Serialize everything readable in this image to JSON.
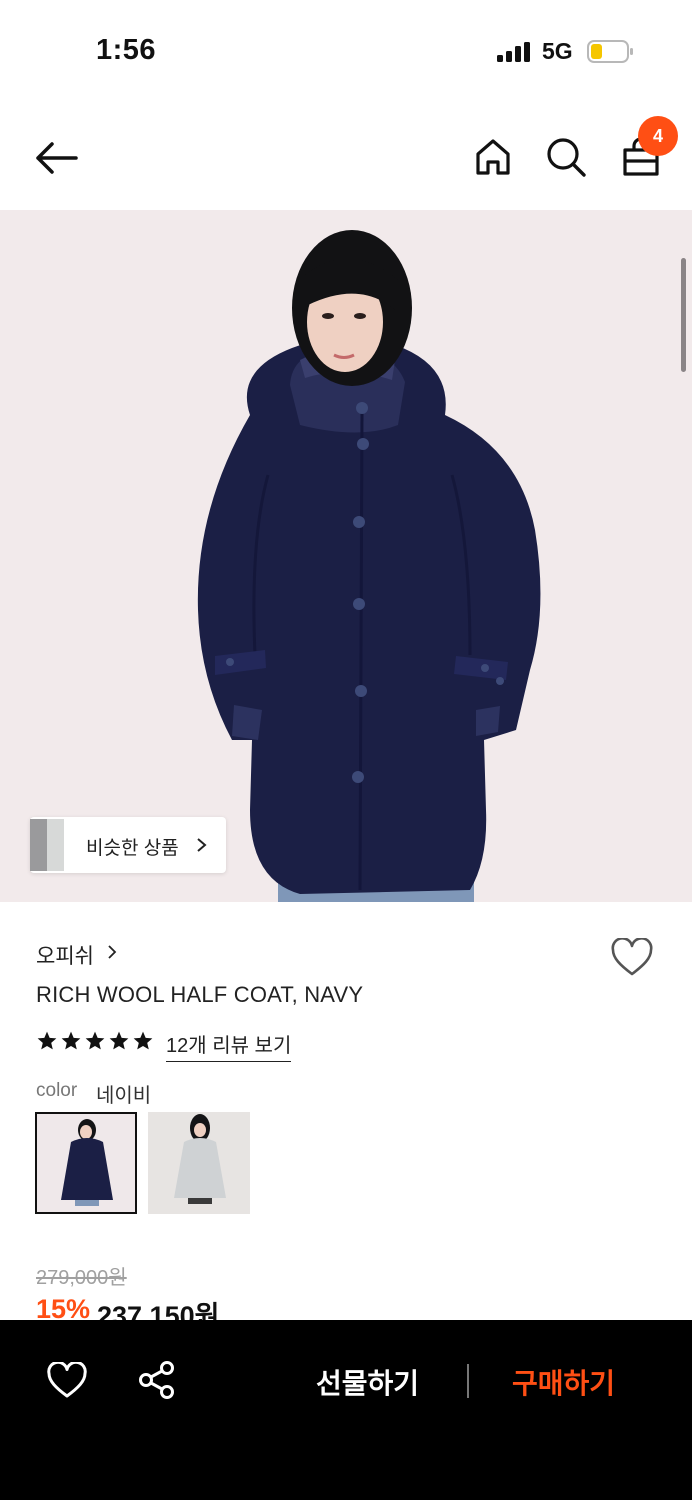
{
  "status_bar": {
    "time": "1:56",
    "network": "5G",
    "icons": [
      "signal-icon",
      "battery-icon"
    ],
    "battery_color": "#f5c600"
  },
  "nav": {
    "icons": [
      "back-arrow-icon",
      "home-icon",
      "search-icon",
      "shopping-bag-icon"
    ],
    "cart_count": "4",
    "badge_color": "#ff4f14"
  },
  "hero": {
    "similar_label": "비슷한 상품",
    "icons": [
      "chevron-right-icon"
    ]
  },
  "product": {
    "brand": "오피쉬",
    "name": "RICH WOOL HALF COAT, NAVY",
    "rating_stars": 5,
    "reviews_link": "12개 리뷰 보기",
    "color_label": "color",
    "color_value": "네이비",
    "swatches": [
      "navy",
      "grey"
    ],
    "original_price": "279,000원",
    "discount": "15%",
    "sale_price": "237,150원",
    "accent_color": "#ff4f14"
  },
  "bottom_bar": {
    "gift_label": "선물하기",
    "buy_label": "구매하기",
    "icons": [
      "heart-icon",
      "share-icon"
    ]
  }
}
